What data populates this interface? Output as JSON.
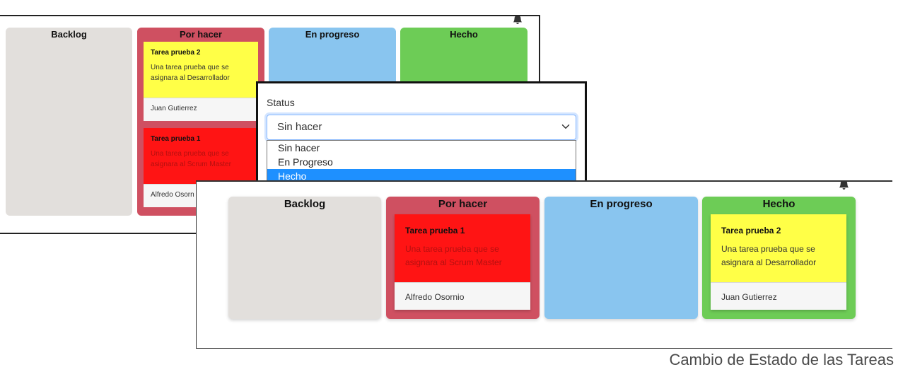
{
  "back_board": {
    "columns": [
      {
        "title": "Backlog"
      },
      {
        "title": "Por hacer"
      },
      {
        "title": "En progreso"
      },
      {
        "title": "Hecho"
      }
    ],
    "cards": [
      {
        "title": "Tarea prueba 2",
        "description": "Una tarea prueba que se asignara al Desarrollador",
        "assignee": "Juan Gutierrez",
        "color": "#ffff47"
      },
      {
        "title": "Tarea prueba 1",
        "description": "Una tarea prueba que se asignara al Scrum Master",
        "assignee": "Alfredo Osorn",
        "color": "#ff1414"
      }
    ]
  },
  "status_form": {
    "label": "Status",
    "selected_value": "Sin hacer",
    "options": [
      "Sin hacer",
      "En Progreso",
      "Hecho"
    ],
    "highlighted_option": "Hecho"
  },
  "front_board": {
    "columns": [
      {
        "title": "Backlog"
      },
      {
        "title": "Por hacer"
      },
      {
        "title": "En progreso"
      },
      {
        "title": "Hecho"
      }
    ],
    "cards": [
      {
        "title": "Tarea prueba 1",
        "description": "Una tarea prueba que se asignara al Scrum Master",
        "assignee": "Alfredo Osornio",
        "color": "#ff1414"
      },
      {
        "title": "Tarea prueba 2",
        "description": "Una tarea prueba que se asignara al Desarrollador",
        "assignee": "Juan Gutierrez",
        "color": "#ffff47"
      }
    ]
  },
  "icons": {
    "notifications": "bell-icon",
    "select_caret": "chevron-down-icon"
  },
  "colors": {
    "backlog": "#e2dfdc",
    "por_hacer": "#cf5061",
    "en_progreso": "#89c5ef",
    "hecho": "#6dcc56",
    "select_highlight": "#1e90ff"
  },
  "caption": "Cambio de Estado de las Tareas"
}
